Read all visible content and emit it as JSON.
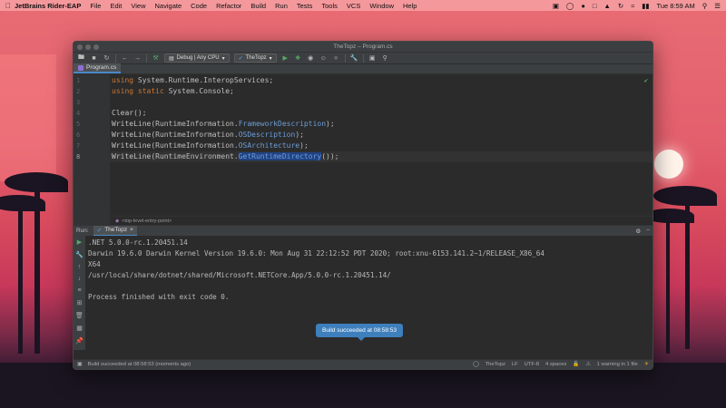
{
  "menubar": {
    "app": "JetBrains Rider-EAP",
    "items": [
      "File",
      "Edit",
      "View",
      "Navigate",
      "Code",
      "Refactor",
      "Build",
      "Run",
      "Tests",
      "Tools",
      "VCS",
      "Window",
      "Help"
    ],
    "clock": "Tue 8:59 AM"
  },
  "window": {
    "title": "TheTopz – Program.cs"
  },
  "toolbar": {
    "config": "Debug | Any CPU",
    "project": "TheTopz"
  },
  "tabs": [
    {
      "label": "Program.cs"
    }
  ],
  "editor": {
    "line_numbers": [
      "1",
      "2",
      "3",
      "4",
      "5",
      "6",
      "7",
      "8"
    ],
    "hint": "<top-level-entry-point>"
  },
  "code": {
    "l1": {
      "kw": "using",
      "rest": " System.Runtime.InteropServices;"
    },
    "l2": {
      "kw": "using static",
      "ns": " System.",
      "cls": "Console",
      "end": ";"
    },
    "l4": {
      "fn": "Clear",
      "end": "();"
    },
    "l5": {
      "fn": "WriteLine",
      "a": "(RuntimeInformation.",
      "m": "FrameworkDescription",
      "end": ");"
    },
    "l6": {
      "fn": "WriteLine",
      "a": "(RuntimeInformation.",
      "m": "OSDescription",
      "end": ");"
    },
    "l7": {
      "fn": "WriteLine",
      "a": "(RuntimeInformation.",
      "m": "OSArchitecture",
      "end": ");"
    },
    "l8": {
      "fn": "WriteLine",
      "a": "(RuntimeEnvironment.",
      "m": "GetRuntimeDirectory",
      "end": "());"
    }
  },
  "run": {
    "label": "Run:",
    "tab": "TheTopz"
  },
  "console": {
    "lines": [
      ".NET 5.0.0-rc.1.20451.14",
      "Darwin 19.6.0 Darwin Kernel Version 19.6.0: Mon Aug 31 22:12:52 PDT 2020; root:xnu-6153.141.2~1/RELEASE_X86_64",
      "X64",
      "/usr/local/share/dotnet/shared/Microsoft.NETCore.App/5.0.0-rc.1.20451.14/",
      "",
      "Process finished with exit code 0."
    ]
  },
  "toast": "Build succeeded at 08:58:53",
  "statusbar": {
    "message": "Build succeeded at 08:58:53 (moments ago)",
    "project": "TheTopz",
    "line_sep": "LF",
    "encoding": "UTF-8",
    "indent": "4 spaces",
    "warnings": "1 warning in 1 file"
  }
}
